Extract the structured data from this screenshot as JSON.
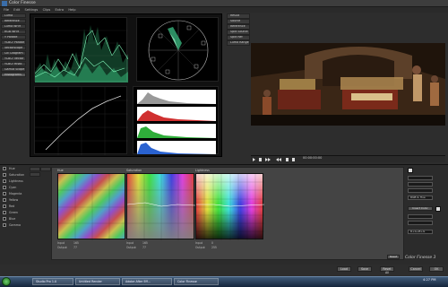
{
  "window": {
    "title": "Color Finesse"
  },
  "menu": [
    "File",
    "Edit",
    "Settings",
    "Clips",
    "Extra",
    "Help"
  ],
  "left_tabs": [
    {
      "label": "Luma",
      "active": false
    },
    {
      "label": "Reference",
      "active": false
    },
    {
      "label": "Luma WFM",
      "active": false
    },
    {
      "label": "RGB WFM",
      "active": false
    },
    {
      "label": "Y Parade",
      "active": false
    },
    {
      "label": "YCbCr Parade",
      "active": false
    },
    {
      "label": "Vectorscope",
      "active": false
    },
    {
      "label": "CIE Diagram",
      "active": false
    },
    {
      "label": "YCbCr Vector",
      "active": false
    },
    {
      "label": "YCbCr Histo",
      "active": false
    },
    {
      "label": "Gamut Scope",
      "active": false
    },
    {
      "label": "Histograms",
      "active": true
    }
  ],
  "right_tabs": [
    {
      "label": "Result",
      "active": false
    },
    {
      "label": "Source",
      "active": false
    },
    {
      "label": "Reference",
      "active": false
    },
    {
      "label": "Split Source",
      "active": false
    },
    {
      "label": "Split Ref",
      "active": false
    },
    {
      "label": "Luma Range",
      "active": false
    }
  ],
  "timecode": "00:00:00:00",
  "channels": [
    "Hue",
    "Saturation",
    "Lightness",
    "Cyan",
    "Magenta",
    "Yellow",
    "Red",
    "Green",
    "Blue",
    "Gamma"
  ],
  "grids": [
    {
      "title": "Hue",
      "input_label": "Input",
      "input_value": "165",
      "output_label": "Output",
      "output_value": "77"
    },
    {
      "title": "Saturation",
      "input_label": "Input",
      "input_value": "165",
      "output_label": "Output",
      "output_value": "77"
    },
    {
      "title": "Lightness",
      "input_label": "Input",
      "input_value": "0",
      "output_label": "Output",
      "output_value": "255"
    }
  ],
  "right_controls": {
    "select1": "RGB & Hue",
    "select2": "R+G+B+G",
    "reset_label": "Reset",
    "insert_label": "Insert Color"
  },
  "logo": "Color Finesse 3",
  "bottom_buttons": [
    "Load",
    "Save",
    "Reset All",
    "Cancel",
    "OK"
  ],
  "taskbar": {
    "items": [
      "Studio Pro 1.0",
      "Untitled Render",
      "Adobe After Eff...",
      "Color Finesse"
    ],
    "clock": "4:27 PM"
  },
  "colors": {
    "accent": "#575757",
    "wave": "#3fd38a",
    "vector": "#37b07b"
  }
}
